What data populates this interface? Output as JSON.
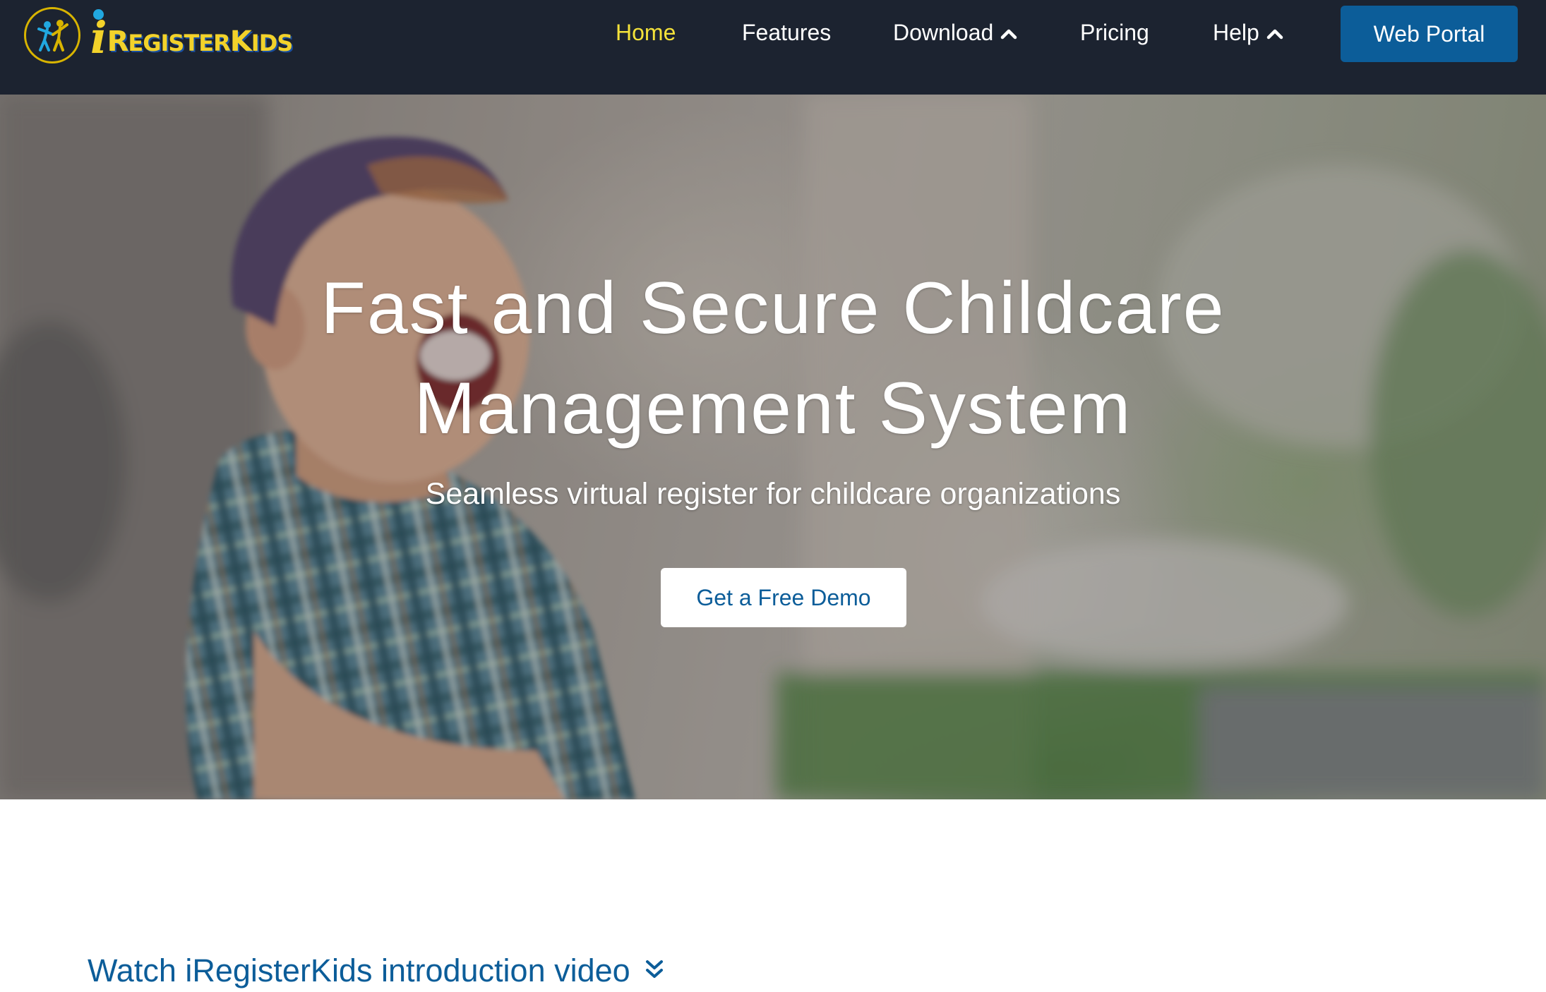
{
  "brand": {
    "name": "iRegisterKids",
    "logo_letter": "i",
    "logo_text_parts": [
      "R",
      "EGISTER",
      "K",
      "IDS"
    ]
  },
  "nav": {
    "items": [
      {
        "label": "Home",
        "active": true
      },
      {
        "label": "Features"
      },
      {
        "label": "Download",
        "icon": "chevron-up-icon"
      },
      {
        "label": "Pricing"
      },
      {
        "label": "Help",
        "icon": "chevron-up-icon"
      }
    ],
    "portal_button": "Web Portal"
  },
  "hero": {
    "title": "Fast and Secure Childcare Management System",
    "subtitle": "Seamless virtual register for childcare organizations",
    "cta": "Get a Free Demo",
    "background": "photo of a laughing toddler in a cap and plaid shirt"
  },
  "video": {
    "label": "Watch iRegisterKids introduction video",
    "icon": "double-chevron-down-icon"
  },
  "colors": {
    "navbar_bg": "#1c2330",
    "nav_active": "#f4e23a",
    "brand_blue": "#0c5d99",
    "logo_yellow": "#f2d22a",
    "logo_dot": "#21a8e0",
    "white": "#ffffff"
  }
}
